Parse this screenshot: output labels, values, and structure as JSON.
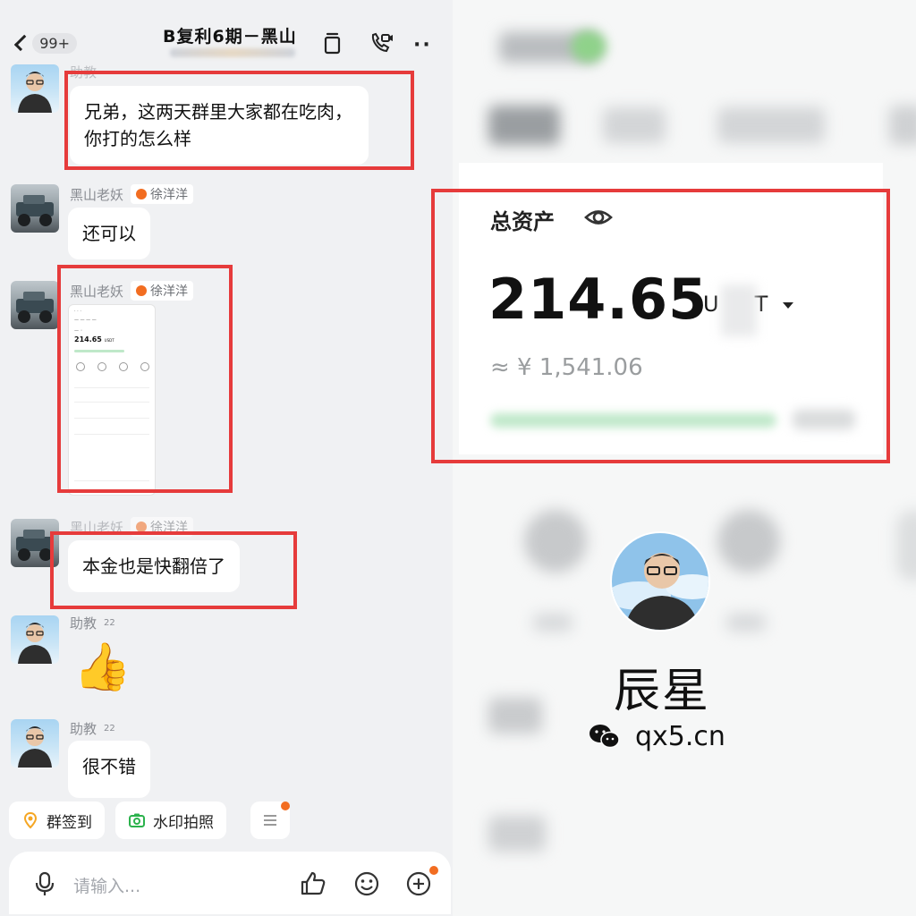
{
  "chat": {
    "back": {
      "unread_count": "99+"
    },
    "title": "B复利6期－黑山",
    "messages": [
      {
        "sender": "助教",
        "text": "兄弟，这两天群里大家都在吃肉，你打的怎么样"
      },
      {
        "sender": "黑山老妖",
        "tag": "徐洋洋",
        "text": "还可以"
      },
      {
        "sender": "黑山老妖",
        "tag": "徐洋洋",
        "type": "image",
        "image_content": {
          "amount": "214.65",
          "unit": "USDT"
        }
      },
      {
        "sender": "黑山老妖",
        "tag": "徐洋洋",
        "text": "本金也是快翻倍了"
      },
      {
        "sender": "助教",
        "sender_sup": "22",
        "type": "emoji",
        "emoji": "👍"
      },
      {
        "sender": "助教",
        "sender_sup": "22",
        "text": "很不错"
      }
    ],
    "quick_actions": [
      {
        "label": "群签到",
        "icon": "location-pin-icon",
        "color": "#f5a623"
      },
      {
        "label": "水印拍照",
        "icon": "camera-icon",
        "color": "#2bb24c"
      }
    ],
    "input": {
      "placeholder": "请输入..."
    }
  },
  "wallet": {
    "total_assets_label": "总资产",
    "amount": "214.65",
    "unit_visible": "U",
    "unit_tail": "T",
    "cny_equivalent": "≈ ¥ 1,541.06"
  },
  "profile": {
    "name": "辰星",
    "site": "qx5.cn"
  },
  "colors": {
    "highlight_border": "#e63b3b",
    "chat_bg": "#f0f1f3",
    "badge_orange": "#f26d21"
  }
}
